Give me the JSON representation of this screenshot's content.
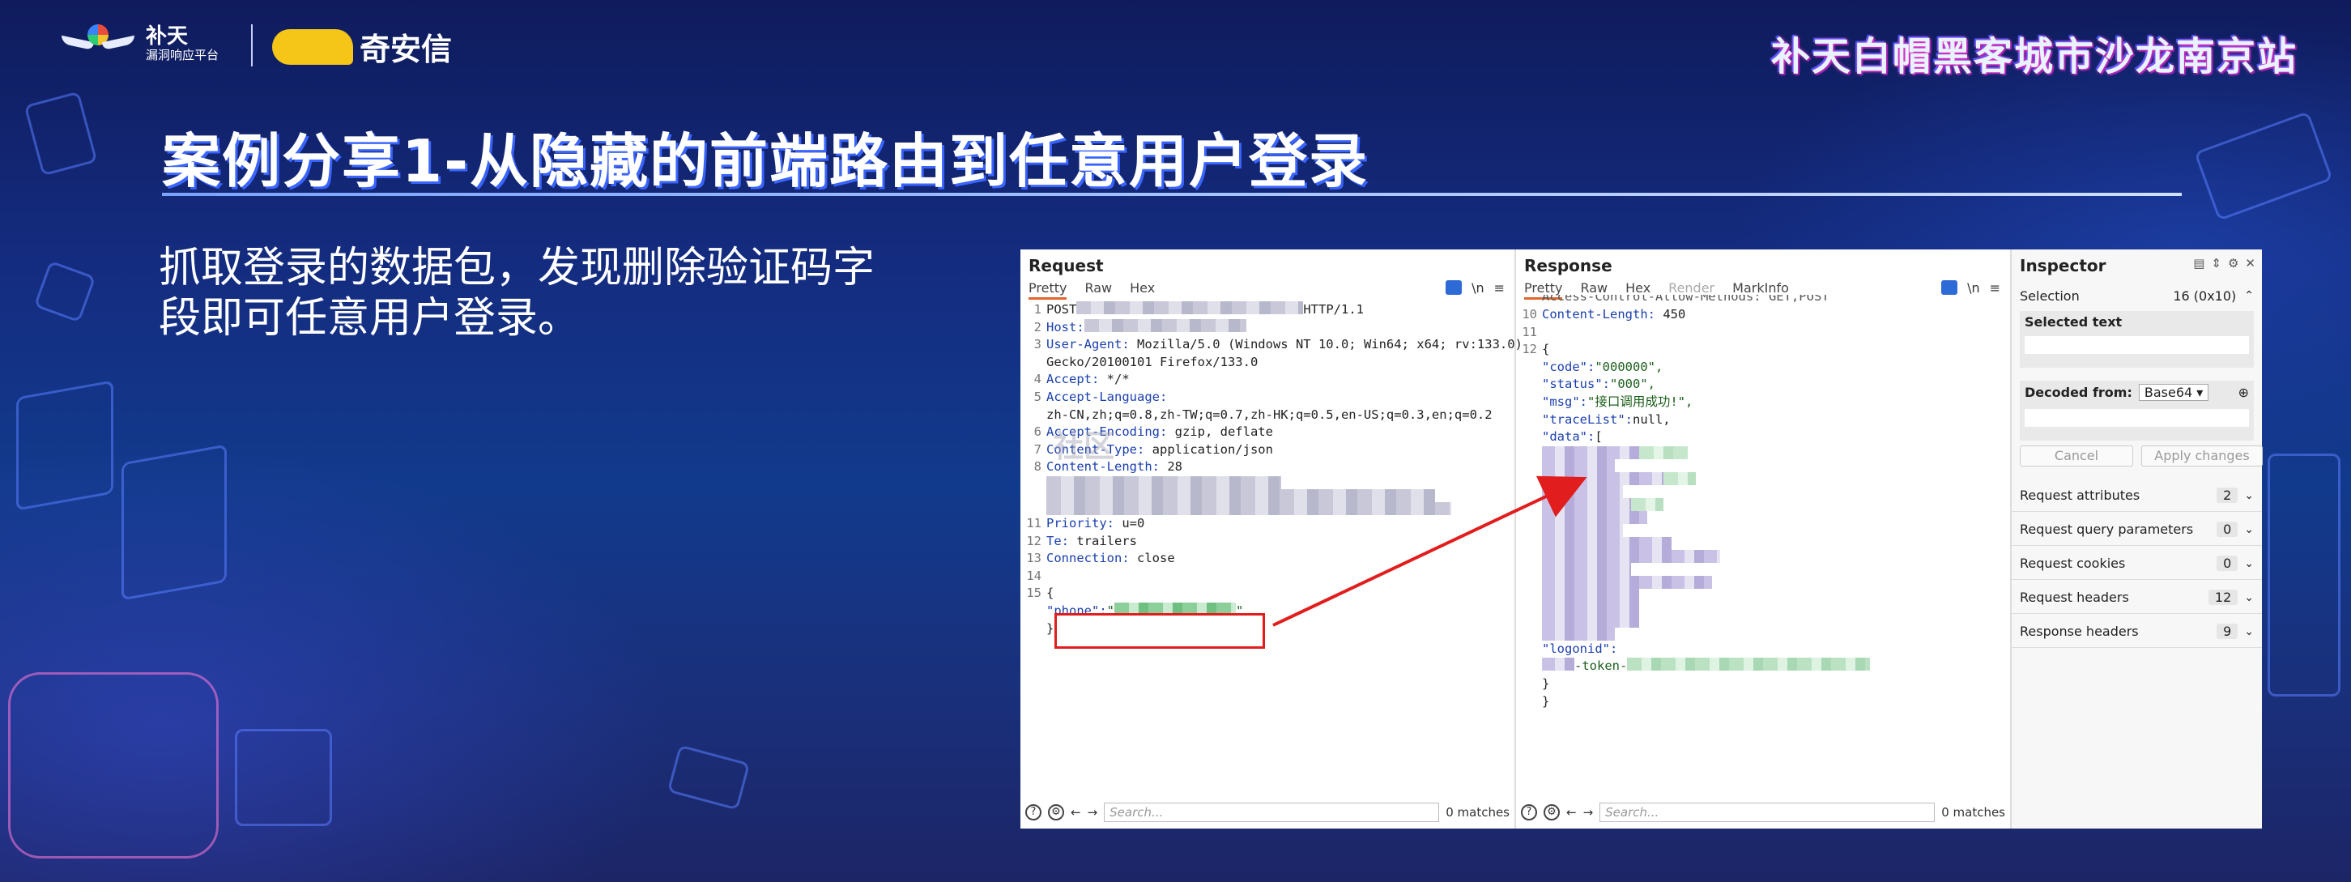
{
  "header": {
    "logo1_name": "补天",
    "logo1_sub": "漏洞响应平台",
    "logo2_name": "奇安信",
    "event_banner": "补天白帽黑客城市沙龙南京站"
  },
  "slide": {
    "title": "案例分享1-从隐藏的前端路由到任意用户登录",
    "description": "抓取登录的数据包，发现删除验证码字段即可任意用户登录。"
  },
  "watermark": "社区",
  "request": {
    "title": "Request",
    "tabs": [
      "Pretty",
      "Raw",
      "Hex"
    ],
    "tool_ln": "\\n",
    "tool_menu": "≡",
    "lines": {
      "l1_method": "POST",
      "l1_proto": "HTTP/1.1",
      "l2_key": "Host:",
      "l3_key": "User-Agent:",
      "l3_val": " Mozilla/5.0 (Windows NT 10.0; Win64; x64; rv:133.0)",
      "l3b_val": "Gecko/20100101 Firefox/133.0",
      "l4_key": "Accept:",
      "l4_val": " */*",
      "l5_key": "Accept-Language:",
      "l5b_val": "zh-CN,zh;q=0.8,zh-TW;q=0.7,zh-HK;q=0.5,en-US;q=0.3,en;q=0.2",
      "l6_key": "Accept-Encoding:",
      "l6_val": " gzip, deflate",
      "l7_key": "Content-Type:",
      "l7_val": " application/json",
      "l8_key": "Content-Length:",
      "l8_val": " 28",
      "l11_key": "Priority:",
      "l11_val": " u=0",
      "l12_key": "Te:",
      "l12_val": " trailers",
      "l13_key": "Connection:",
      "l13_val": " close",
      "l15_open": "{",
      "l15_key": "\"phone\":",
      "l15_q": "\"",
      "l16_close": "}"
    },
    "search_placeholder": "Search...",
    "matches": "0 matches"
  },
  "response": {
    "title": "Response",
    "tabs": [
      "Pretty",
      "Raw",
      "Hex",
      "Render",
      "MarkInfo"
    ],
    "tool_ln": "\\n",
    "tool_menu": "≡",
    "lines": {
      "l9_partial": "Access-Control-Allow-Methods: GET,POST",
      "l10_key": "Content-Length:",
      "l10_val": " 450",
      "l12_open": "{",
      "code_key": "\"code\":",
      "code_val": "\"000000\",",
      "status_key": "\"status\":",
      "status_val": "\"000\",",
      "msg_key": "\"msg\":",
      "msg_val": "\"接口调用成功!\",",
      "trace_key": "\"traceList\":",
      "trace_val": "null,",
      "data_key": "\"data\":",
      "data_val": "[",
      "logonid_key": "\"logonid\":",
      "token_val": "-token-",
      "close_obj": "}",
      "close_all": "}"
    },
    "search_placeholder": "Search...",
    "matches": "0 matches"
  },
  "inspector": {
    "title": "Inspector",
    "selection_label": "Selection",
    "selection_value": "16 (0x10)",
    "selected_text_label": "Selected text",
    "decoded_from_label": "Decoded from:",
    "decoded_from_value": "Base64",
    "cancel_label": "Cancel",
    "apply_label": "Apply changes",
    "sections": [
      {
        "label": "Request attributes",
        "count": "2"
      },
      {
        "label": "Request query parameters",
        "count": "0"
      },
      {
        "label": "Request cookies",
        "count": "0"
      },
      {
        "label": "Request headers",
        "count": "12"
      },
      {
        "label": "Response headers",
        "count": "9"
      }
    ]
  },
  "colors": {
    "highlight_box": "#e11d1d",
    "arrow": "#e11d1d",
    "tab_active": "#e0672d"
  }
}
